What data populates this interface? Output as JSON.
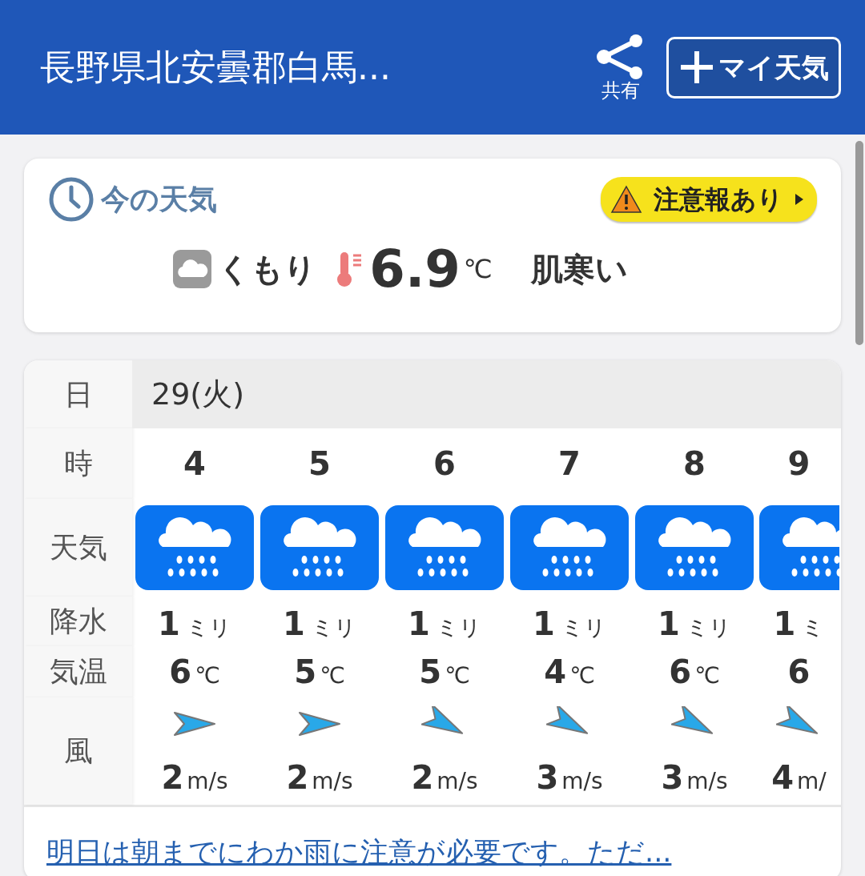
{
  "header": {
    "title": "長野県北安曇郡白馬...",
    "share_label": "共有",
    "my_weather_button": "マイ天気"
  },
  "current": {
    "title": "今の天気",
    "alert": "注意報あり",
    "condition": "くもり",
    "temperature": "6.9",
    "temp_unit": "℃",
    "feeling": "肌寒い"
  },
  "forecast": {
    "row_labels": [
      "日",
      "時",
      "天気",
      "降水",
      "気温",
      "風"
    ],
    "date": "29(火)",
    "hours": [
      {
        "kind": "rain",
        "hour": "4",
        "precip": "1",
        "precip_unit": "ミリ",
        "temp": "6",
        "temp_unit": "℃",
        "wind": {
          "kind": "east",
          "speed": "2",
          "unit": "m/s"
        }
      },
      {
        "kind": "rain",
        "hour": "5",
        "precip": "1",
        "precip_unit": "ミリ",
        "temp": "5",
        "temp_unit": "℃",
        "wind": {
          "kind": "east",
          "speed": "2",
          "unit": "m/s"
        }
      },
      {
        "kind": "rain",
        "hour": "6",
        "precip": "1",
        "precip_unit": "ミリ",
        "temp": "5",
        "temp_unit": "℃",
        "wind": {
          "kind": "southeast",
          "speed": "2",
          "unit": "m/s"
        }
      },
      {
        "kind": "rain",
        "hour": "7",
        "precip": "1",
        "precip_unit": "ミリ",
        "temp": "4",
        "temp_unit": "℃",
        "wind": {
          "kind": "southeast",
          "speed": "3",
          "unit": "m/s"
        }
      },
      {
        "kind": "rain",
        "hour": "8",
        "precip": "1",
        "precip_unit": "ミリ",
        "temp": "6",
        "temp_unit": "℃",
        "wind": {
          "kind": "southeast",
          "speed": "3",
          "unit": "m/s"
        }
      },
      {
        "kind": "rain",
        "hour": "9",
        "precip": "1",
        "precip_unit": "ミ",
        "temp": "6",
        "wind": {
          "kind": "southeast",
          "speed": "4",
          "unit": "m/"
        }
      }
    ]
  },
  "summary_link": "明日は朝までにわか雨に注意が必要です。ただ..."
}
